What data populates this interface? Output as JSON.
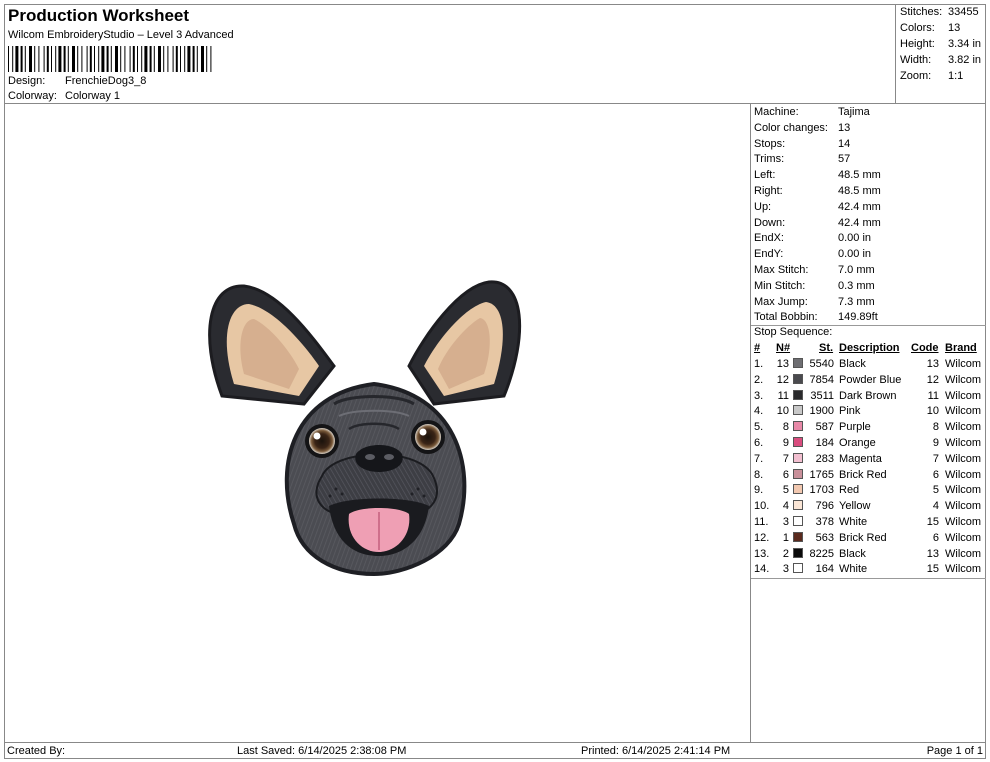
{
  "header": {
    "title": "Production Worksheet",
    "subtitle": "Wilcom EmbroideryStudio – Level 3 Advanced",
    "design_label": "Design:",
    "design_value": "FrenchieDog3_8",
    "colorway_label": "Colorway:",
    "colorway_value": "Colorway 1"
  },
  "summary": {
    "stitches_label": "Stitches:",
    "stitches": "33455",
    "colors_label": "Colors:",
    "colors": "13",
    "height_label": "Height:",
    "height": "3.34 in",
    "width_label": "Width:",
    "width": "3.82 in",
    "zoom_label": "Zoom:",
    "zoom": "1:1"
  },
  "machine_info": [
    {
      "label": "Machine:",
      "value": "Tajima"
    },
    {
      "label": "Color changes:",
      "value": "13"
    },
    {
      "label": "Stops:",
      "value": "14"
    },
    {
      "label": "Trims:",
      "value": "57"
    },
    {
      "label": "Left:",
      "value": "48.5 mm"
    },
    {
      "label": "Right:",
      "value": "48.5 mm"
    },
    {
      "label": "Up:",
      "value": "42.4 mm"
    },
    {
      "label": "Down:",
      "value": "42.4 mm"
    },
    {
      "label": "EndX:",
      "value": "0.00 in"
    },
    {
      "label": "EndY:",
      "value": "0.00 in"
    },
    {
      "label": "Max Stitch:",
      "value": "7.0 mm"
    },
    {
      "label": "Min Stitch:",
      "value": "0.3 mm"
    },
    {
      "label": "Max Jump:",
      "value": "7.3 mm"
    },
    {
      "label": "Total Bobbin:",
      "value": "149.89ft"
    }
  ],
  "stop_sequence": {
    "heading": "Stop Sequence:",
    "columns": [
      "#",
      "N#",
      "St.",
      "Description",
      "Code",
      "Brand"
    ],
    "rows": [
      {
        "num": "1.",
        "n": "13",
        "color": "#6e6e72",
        "st": "5540",
        "desc": "Black",
        "code": "13",
        "brand": "Wilcom"
      },
      {
        "num": "2.",
        "n": "12",
        "color": "#4a4a4e",
        "st": "7854",
        "desc": "Powder Blue",
        "code": "12",
        "brand": "Wilcom"
      },
      {
        "num": "3.",
        "n": "11",
        "color": "#2a2a2c",
        "st": "3511",
        "desc": "Dark Brown",
        "code": "11",
        "brand": "Wilcom"
      },
      {
        "num": "4.",
        "n": "10",
        "color": "#c8c8c8",
        "st": "1900",
        "desc": "Pink",
        "code": "10",
        "brand": "Wilcom"
      },
      {
        "num": "5.",
        "n": "8",
        "color": "#e889a8",
        "st": "587",
        "desc": "Purple",
        "code": "8",
        "brand": "Wilcom"
      },
      {
        "num": "6.",
        "n": "9",
        "color": "#d94c7e",
        "st": "184",
        "desc": "Orange",
        "code": "9",
        "brand": "Wilcom"
      },
      {
        "num": "7.",
        "n": "7",
        "color": "#f2bfd0",
        "st": "283",
        "desc": "Magenta",
        "code": "7",
        "brand": "Wilcom"
      },
      {
        "num": "8.",
        "n": "6",
        "color": "#c9909a",
        "st": "1765",
        "desc": "Brick Red",
        "code": "6",
        "brand": "Wilcom"
      },
      {
        "num": "9.",
        "n": "5",
        "color": "#f2c8b0",
        "st": "1703",
        "desc": "Red",
        "code": "5",
        "brand": "Wilcom"
      },
      {
        "num": "10.",
        "n": "4",
        "color": "#fbe6d6",
        "st": "796",
        "desc": "Yellow",
        "code": "4",
        "brand": "Wilcom"
      },
      {
        "num": "11.",
        "n": "3",
        "color": "#ffffff",
        "st": "378",
        "desc": "White",
        "code": "15",
        "brand": "Wilcom"
      },
      {
        "num": "12.",
        "n": "1",
        "color": "#5a2a1e",
        "st": "563",
        "desc": "Brick Red",
        "code": "6",
        "brand": "Wilcom"
      },
      {
        "num": "13.",
        "n": "2",
        "color": "#0a0a0a",
        "st": "8225",
        "desc": "Black",
        "code": "13",
        "brand": "Wilcom"
      },
      {
        "num": "14.",
        "n": "3",
        "color": "#ffffff",
        "st": "164",
        "desc": "White",
        "code": "15",
        "brand": "Wilcom"
      }
    ]
  },
  "footer": {
    "created_by": "Created By:",
    "last_saved": "Last Saved: 6/14/2025 2:38:08 PM",
    "printed": "Printed: 6/14/2025 2:41:14 PM",
    "page": "Page 1 of 1"
  },
  "design_image": "french-bulldog-embroidery"
}
